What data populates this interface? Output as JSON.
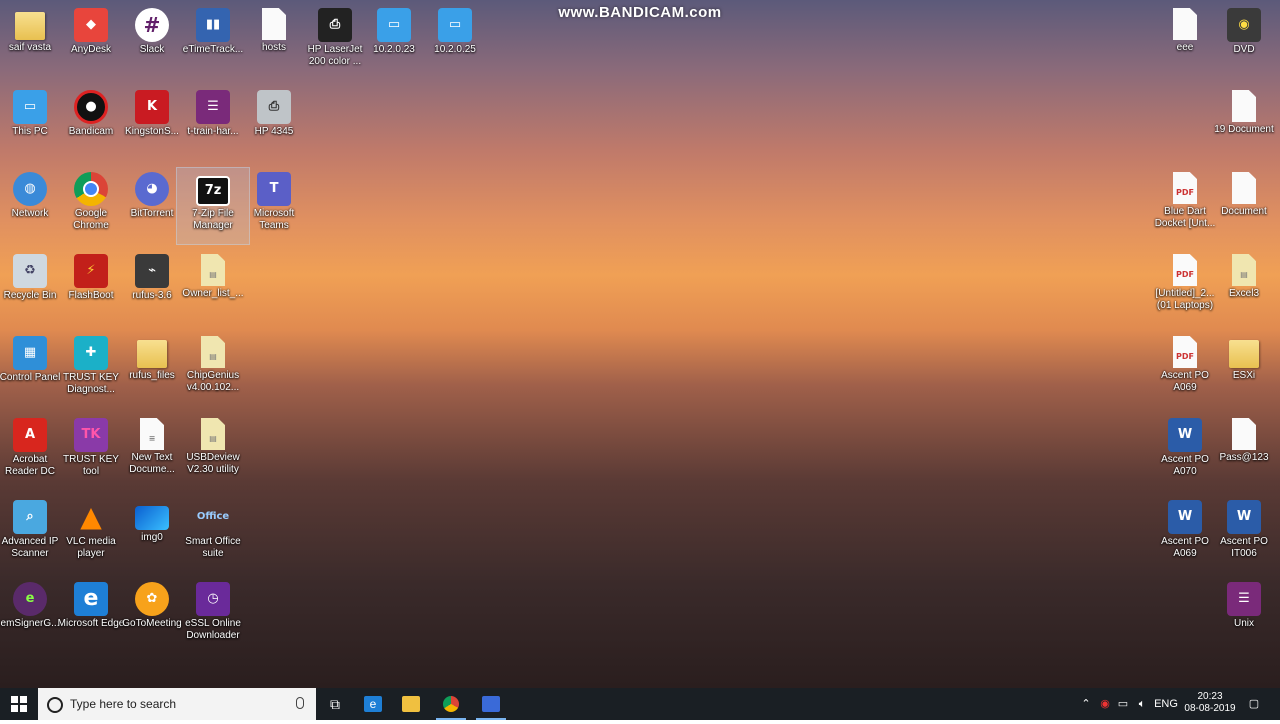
{
  "watermark": "www.BANDICAM.com",
  "icons": {
    "saif_vasta": "saif vasta",
    "anydesk": "AnyDesk",
    "slack": "Slack",
    "etimetrack": "eTimeTrack...",
    "hosts": "hosts",
    "hp_laserjet": "HP LaserJet 200 color ...",
    "ip_10_2_0_23": "10.2.0.23",
    "ip_10_2_0_25": "10.2.0.25",
    "eee": "eee",
    "dvd": "DVD",
    "this_pc": "This PC",
    "bandicam": "Bandicam",
    "kingston": "KingstonS...",
    "t_train": "t-train-har...",
    "hp_4345": "HP 4345",
    "doc_19": "19 Document",
    "network": "Network",
    "google_chrome": "Google Chrome",
    "bittorrent": "BitTorrent",
    "seven_zip": "7-Zip File Manager",
    "ms_teams": "Microsoft Teams",
    "blue_dart": "Blue Dart Docket [Unt...",
    "document": "Document",
    "recycle_bin": "Recycle Bin",
    "flashboot": "FlashBoot",
    "rufus": "rufus-3.6",
    "owner_list": "Owner_list_...",
    "untitled_2": "[Untitled]_2... (01 Laptops)",
    "excel3": "Excel3",
    "control_panel": "Control Panel",
    "trust_diag": "TRUST KEY Diagnost...",
    "rufus_files": "rufus_files",
    "chipgenius": "ChipGenius v4.00.102...",
    "ascent_po_a069_pdf": "Ascent PO A069",
    "esxi": "ESXi",
    "acrobat": "Acrobat Reader DC",
    "trust_tool": "TRUST KEY tool",
    "new_text": "New Text Docume...",
    "usbdeview": "USBDeview V2.30 utility",
    "ascent_po_a070": "Ascent PO A070",
    "pass123": "Pass@123",
    "adv_ip": "Advanced IP Scanner",
    "vlc": "VLC media player",
    "img0": "img0",
    "smart_office": "Smart Office suite",
    "ascent_po_a069_word": "Ascent PO A069",
    "ascent_po_it006": "Ascent PO IT006",
    "emsigner": "emSignerG...",
    "ms_edge": "Microsoft Edge",
    "gotomeeting": "GoToMeeting",
    "essl": "eSSL Online Downloader",
    "unix": "Unix"
  },
  "taskbar": {
    "search_placeholder": "Type here to search",
    "language": "ENG",
    "time": "20:23",
    "date": "08-08-2019"
  },
  "colors": {
    "taskbar_bg": "#1a1f24",
    "accent": "#7ab4f0",
    "icon_label": "#ffffff"
  }
}
